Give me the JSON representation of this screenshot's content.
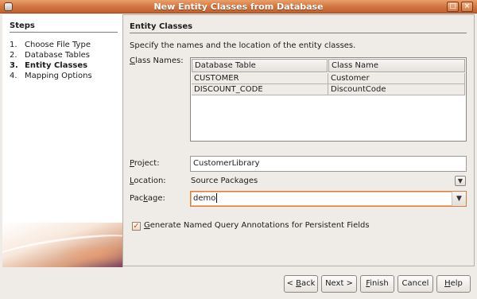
{
  "window": {
    "title": "New Entity Classes from Database",
    "maximize_glyph": "□",
    "close_glyph": "×"
  },
  "steps": {
    "heading": "Steps",
    "items": [
      {
        "num": "1.",
        "label": "Choose File Type"
      },
      {
        "num": "2.",
        "label": "Database Tables"
      },
      {
        "num": "3.",
        "label": "Entity Classes"
      },
      {
        "num": "4.",
        "label": "Mapping Options"
      }
    ]
  },
  "content": {
    "heading": "Entity Classes",
    "description": "Specify the names and the location of the entity classes.",
    "class_names_label_first": "C",
    "class_names_label_rest": "lass Names:",
    "table": {
      "columns": [
        "Database Table",
        "Class Name"
      ],
      "rows": [
        {
          "db_table": "CUSTOMER",
          "class_name": "Customer"
        },
        {
          "db_table": "DISCOUNT_CODE",
          "class_name": "DiscountCode"
        }
      ]
    },
    "project_label_first": "P",
    "project_label_rest": "roject:",
    "project_value": "CustomerLibrary",
    "location_label_first": "L",
    "location_label_rest": "ocation:",
    "location_value": "Source Packages",
    "package_label_pre": "Pac",
    "package_label_u": "k",
    "package_label_post": "age:",
    "package_value": "demo",
    "generate_first": "G",
    "generate_rest": "enerate Named Query Annotations for Persistent Fields",
    "generate_checked": true
  },
  "buttons": {
    "back_pre": "< ",
    "back_u": "B",
    "back_post": "ack",
    "next": "Next >",
    "finish_u": "F",
    "finish_post": "inish",
    "cancel": "Cancel",
    "help_u": "H",
    "help_post": "elp"
  },
  "icons": {
    "dropdown": "chevron-down-icon",
    "check": "check-icon",
    "app": "app-icon"
  },
  "colors": {
    "titlebar": "#d1743f",
    "focus": "#d97c3e",
    "check": "#c0561b"
  }
}
